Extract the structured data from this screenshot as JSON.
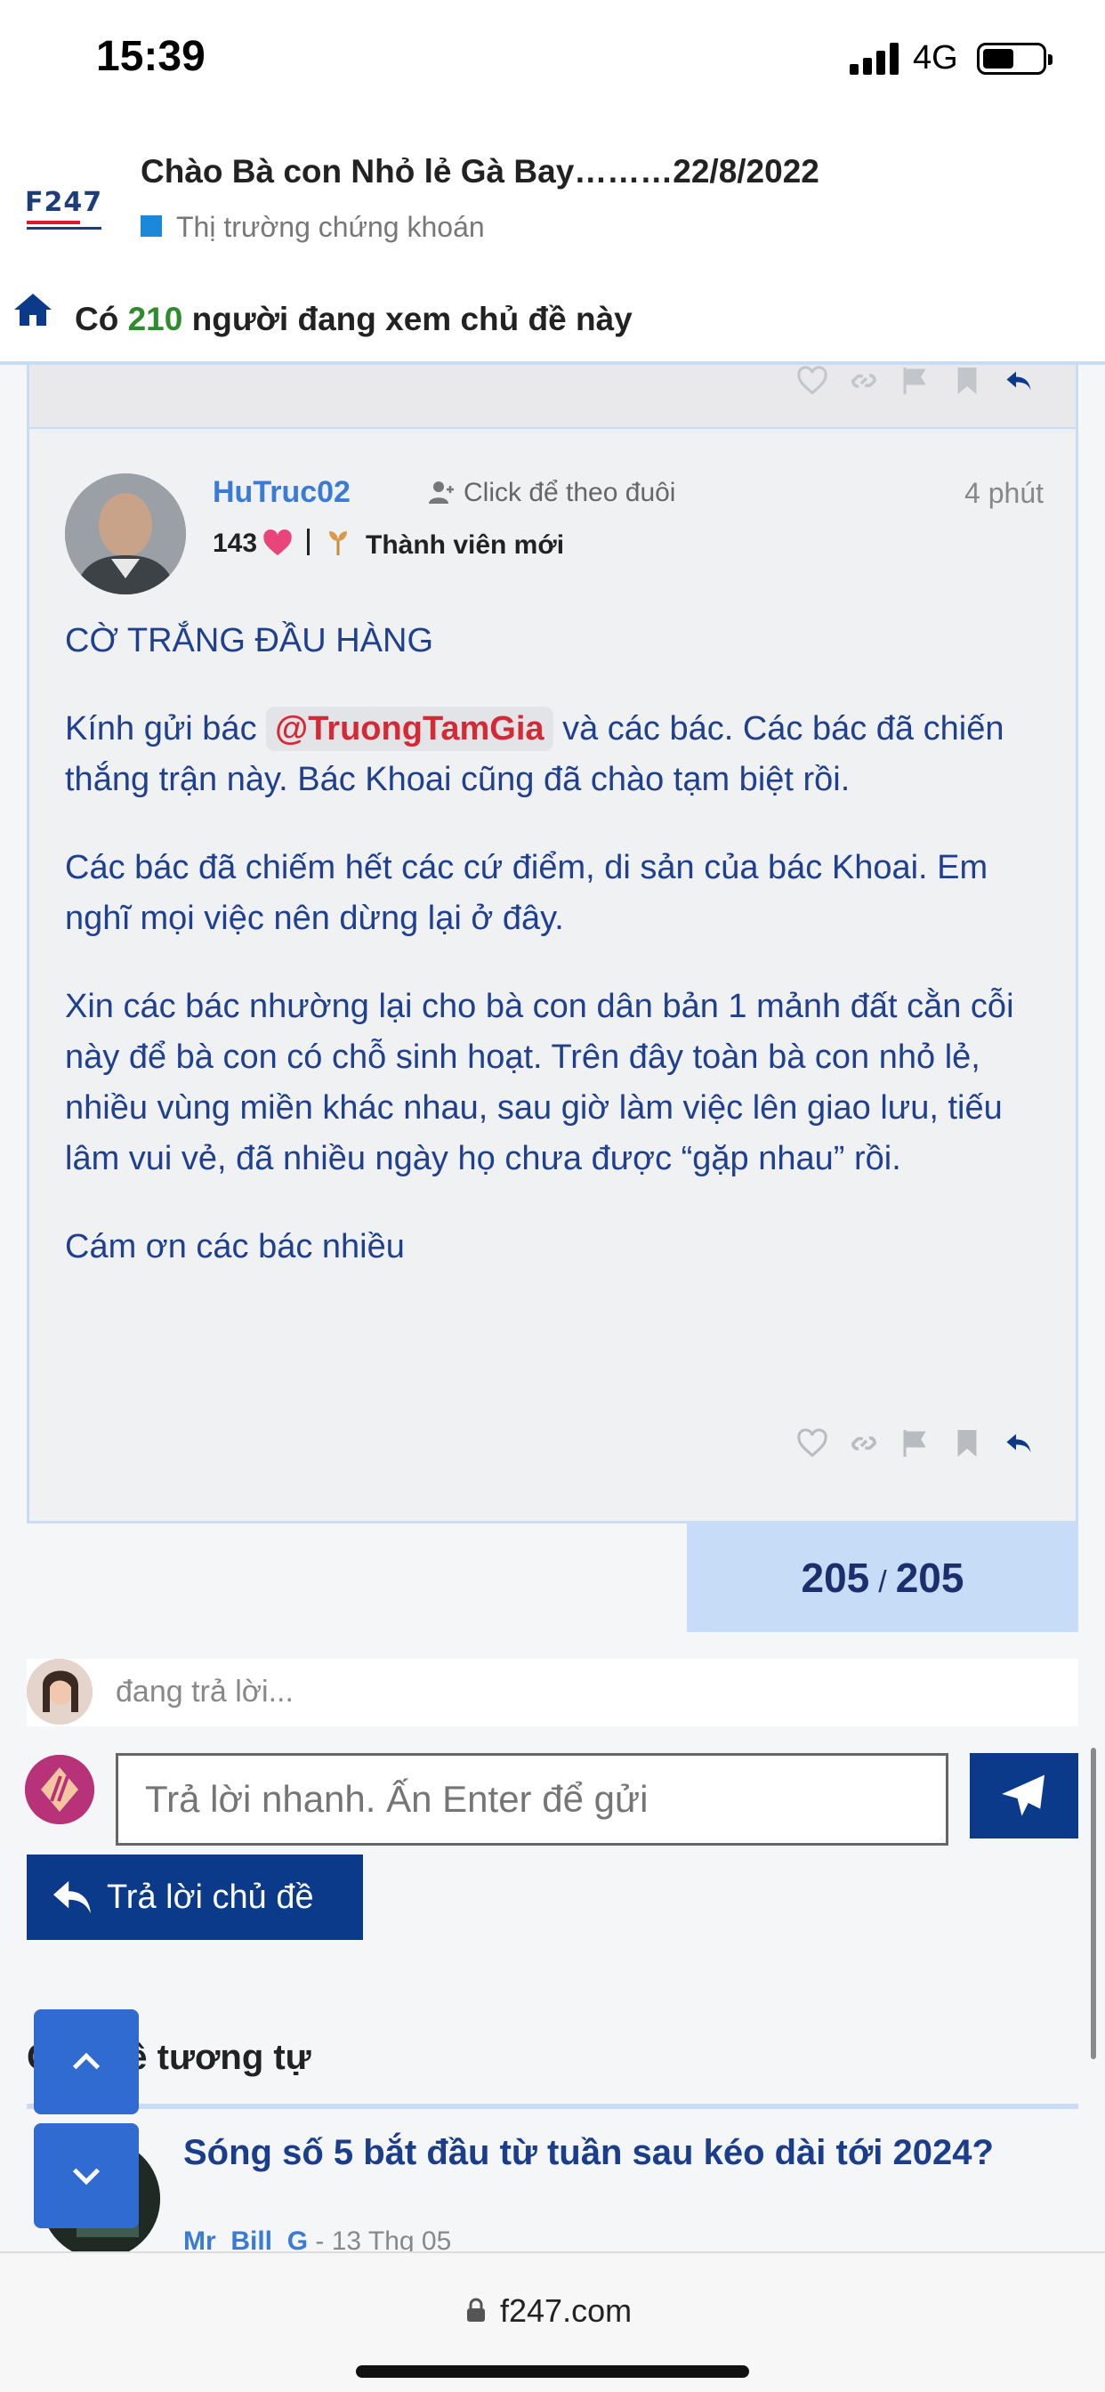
{
  "status_bar": {
    "time": "15:39",
    "network": "4G"
  },
  "topic": {
    "title": "Chào Bà con Nhỏ lẻ Gà Bay………22/8/2022",
    "category": "Thị trường chứng khoán",
    "viewers_prefix": "Có",
    "viewers_count": "210",
    "viewers_suffix": "người đang xem chủ đề này"
  },
  "logo_text": "F247",
  "post": {
    "username": "HuTruc02",
    "follow_label": "Click để theo đuôi",
    "time": "4 phút",
    "likes": "143",
    "rank": "Thành viên mới",
    "heading": "CỜ TRẮNG ĐẦU HÀNG",
    "p1_before": "Kính gửi bác",
    "mention": "@TruongTamGia",
    "p1_after": "và các bác. Các bác đã chiến thắng trận này. Bác Khoai cũng đã chào tạm biệt rồi.",
    "p2": "Các bác đã chiếm hết các cứ điểm, di sản của bác Khoai. Em nghĩ mọi việc nên dừng lại ở đây.",
    "p3": "Xin các bác nhường lại cho bà con dân bản 1 mảnh đất cằn cỗi này để bà con có chỗ sinh hoạt. Trên đây toàn bà con nhỏ lẻ, nhiều vùng miền khác nhau, sau giờ làm việc lên giao lưu, tiếu lâm vui vẻ, đã nhiều ngày họ chưa được “gặp nhau” rồi.",
    "p4": "Cám ơn các bác nhiều"
  },
  "pagination": {
    "current": "205",
    "separator": "/",
    "total": "205"
  },
  "replying": {
    "text": "đang trả lời..."
  },
  "composer": {
    "placeholder": "Trả lời nhanh. Ấn Enter để gửi"
  },
  "reply_topic_label": "Trả lời chủ đề",
  "similar": {
    "heading": "Chủ đề tương tự",
    "items": [
      {
        "title": "Sóng số 5 bắt đầu từ tuần sau kéo dài tới 2024?",
        "author": "Mr_Bill_G",
        "date": " - 13 Thg 05"
      }
    ]
  },
  "browser": {
    "url": "f247.com"
  },
  "colors": {
    "primary": "#0c3a8a",
    "link": "#3a7bd5",
    "mention": "#d42a36",
    "viewer_count": "#2e8b2e",
    "pager_bg": "#c7dcf7"
  }
}
